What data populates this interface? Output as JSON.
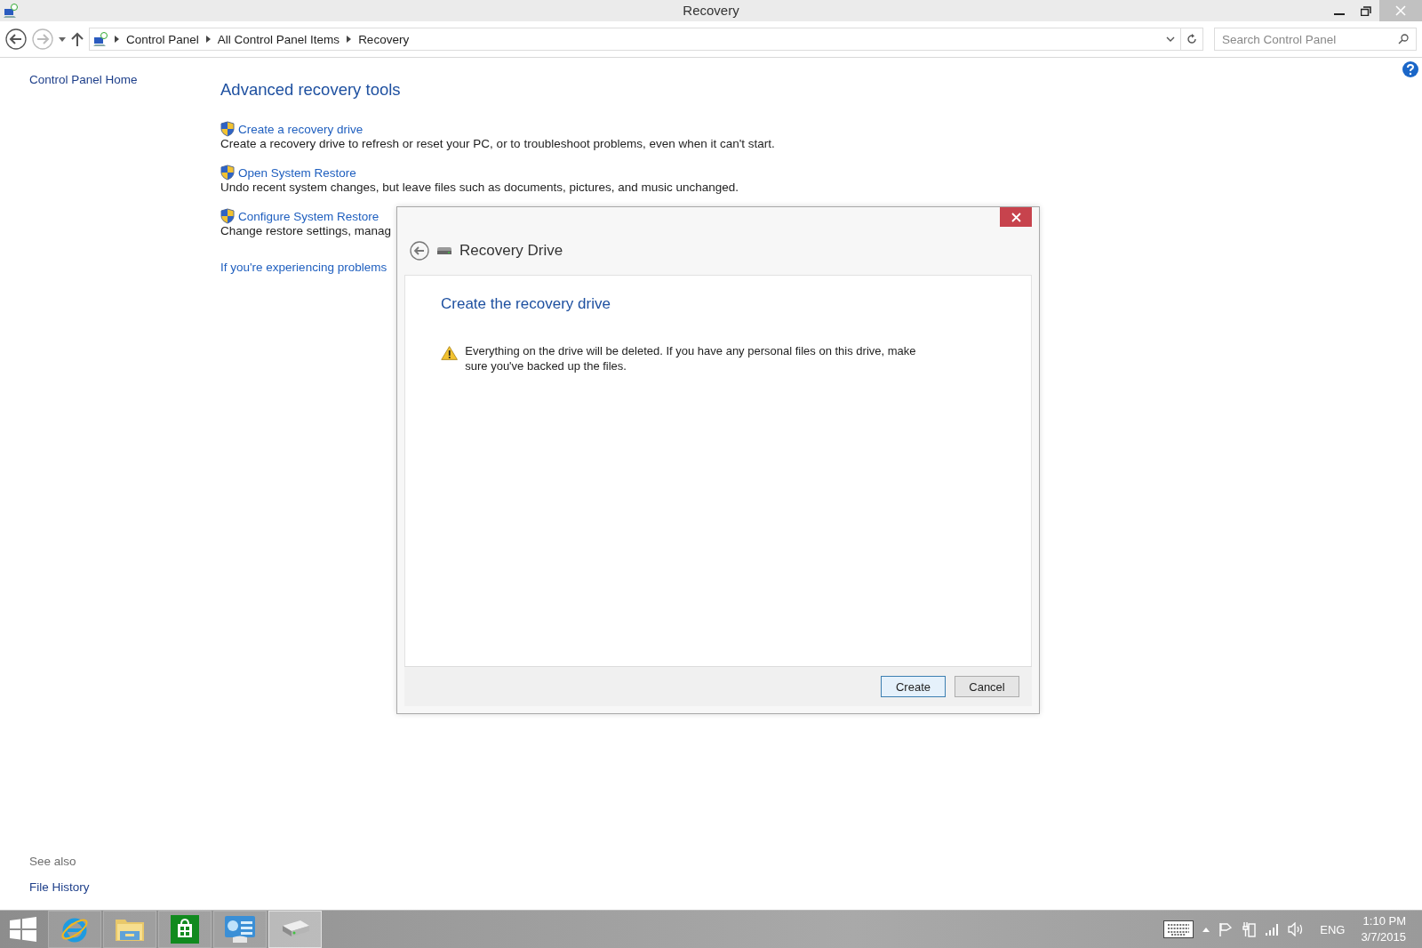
{
  "window": {
    "title": "Recovery"
  },
  "address_bar": {
    "breadcrumbs": [
      "Control Panel",
      "All Control Panel Items",
      "Recovery"
    ],
    "search_placeholder": "Search Control Panel"
  },
  "sidebar": {
    "home_link": "Control Panel Home",
    "see_also_label": "See also",
    "see_also_links": [
      "File History"
    ]
  },
  "main": {
    "heading": "Advanced recovery tools",
    "tasks": [
      {
        "link": "Create a recovery drive",
        "description": "Create a recovery drive to refresh or reset your PC, or to troubleshoot problems, even when it can't start."
      },
      {
        "link": "Open System Restore",
        "description": "Undo recent system changes, but leave files such as documents, pictures, and music unchanged."
      },
      {
        "link": "Configure System Restore",
        "description": "Change restore settings, manag"
      }
    ],
    "problems_link": "If you're experiencing problems"
  },
  "dialog": {
    "title": "Recovery Drive",
    "heading": "Create the recovery drive",
    "warning": "Everything on the drive will be deleted. If you have any personal files on this drive, make sure you've backed up the files.",
    "buttons": [
      {
        "label": "Create",
        "default": true
      },
      {
        "label": "Cancel",
        "default": false
      }
    ]
  },
  "taskbar": {
    "apps": [
      {
        "kind": "start",
        "selected": false
      },
      {
        "kind": "browser",
        "selected": false
      },
      {
        "kind": "folder",
        "selected": false
      },
      {
        "kind": "store",
        "selected": false
      },
      {
        "kind": "control-panel",
        "selected": false
      },
      {
        "kind": "drive",
        "selected": true
      }
    ],
    "language": "ENG",
    "time": "1:10 PM",
    "date": "3/7/2015"
  }
}
